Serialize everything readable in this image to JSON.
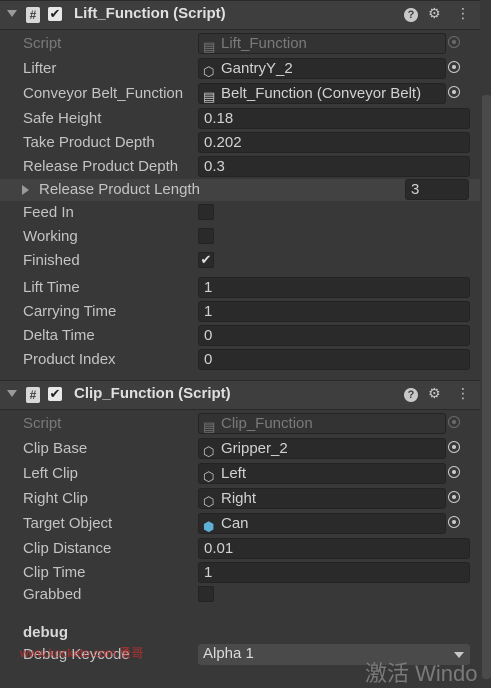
{
  "lift_component": {
    "title": "Lift_Function (Script)",
    "script_label": "Script",
    "script_value": "Lift_Function",
    "fields": {
      "lifter": {
        "label": "Lifter",
        "value": "GantryY_2"
      },
      "conveyor": {
        "label": "Conveyor Belt_Function",
        "value": "Belt_Function (Conveyor Belt)"
      },
      "safe_height": {
        "label": "Safe Height",
        "value": "0.18"
      },
      "take_depth": {
        "label": "Take Product Depth",
        "value": "0.202"
      },
      "release_depth": {
        "label": "Release Product Depth",
        "value": "0.3"
      },
      "release_length": {
        "label": "Release Product Length",
        "value": "3"
      },
      "feed_in": {
        "label": "Feed In",
        "checked": false
      },
      "working": {
        "label": "Working",
        "checked": false
      },
      "finished": {
        "label": "Finished",
        "checked": true,
        "mark": "✔"
      },
      "lift_time": {
        "label": "Lift Time",
        "value": "1"
      },
      "carrying_time": {
        "label": "Carrying Time",
        "value": "1"
      },
      "delta_time": {
        "label": "Delta Time",
        "value": "0"
      },
      "product_index": {
        "label": "Product Index",
        "value": "0"
      }
    }
  },
  "clip_component": {
    "title": "Clip_Function (Script)",
    "script_label": "Script",
    "script_value": "Clip_Function",
    "fields": {
      "clip_base": {
        "label": "Clip Base",
        "value": "Gripper_2"
      },
      "left_clip": {
        "label": "Left Clip",
        "value": "Left"
      },
      "right_clip": {
        "label": "Right Clip",
        "value": "Right"
      },
      "target_object": {
        "label": "Target Object",
        "value": "Can"
      },
      "clip_distance": {
        "label": "Clip Distance",
        "value": "0.01"
      },
      "clip_time": {
        "label": "Clip Time",
        "value": "1"
      },
      "grabbed": {
        "label": "Grabbed",
        "checked": false
      }
    }
  },
  "debug": {
    "section_label": "debug",
    "keycode_label": "Debug Keycode",
    "keycode_value": "Alpha 1"
  },
  "header_icons": {
    "help": "?",
    "settings": "⚙",
    "menu": "⋮",
    "checkmark": "✔",
    "script": "#"
  },
  "overlay": {
    "watermark": "www.kocketo.com  勇哥",
    "activate_text": "激活 Windo"
  }
}
